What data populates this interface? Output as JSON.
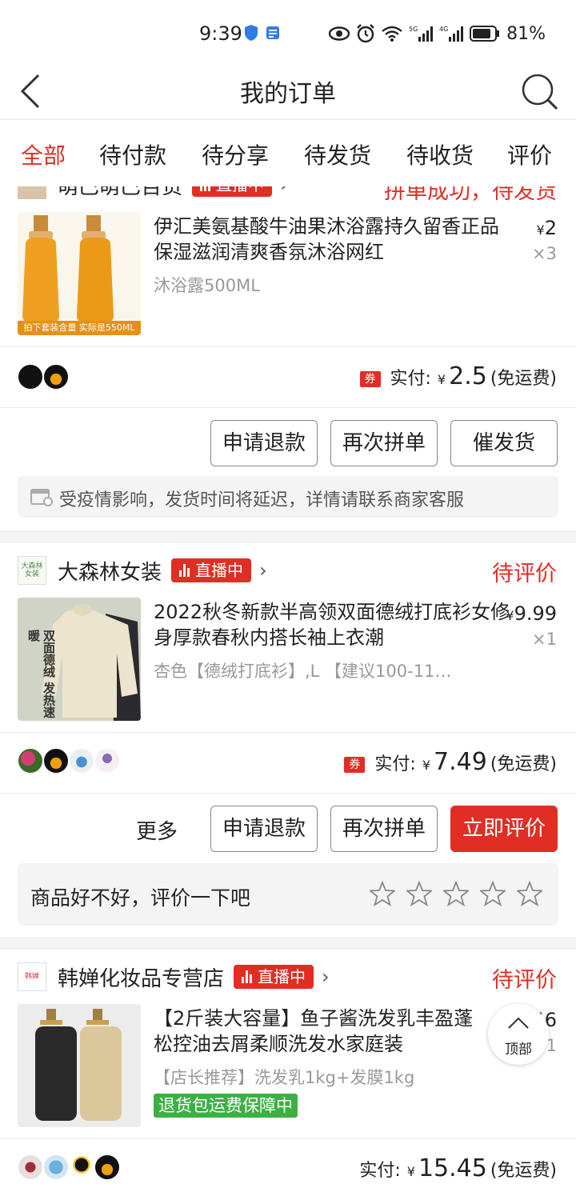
{
  "status_bar": {
    "time": "9:39",
    "battery_pct": "81%",
    "icons": [
      "shield-icon",
      "app-icon",
      "eye-icon",
      "alarm-icon",
      "wifi-icon",
      "signal-5g-icon",
      "signal-4g-icon",
      "battery-icon"
    ]
  },
  "header": {
    "title": "我的订单"
  },
  "tabs": [
    {
      "label": "全部",
      "active": true
    },
    {
      "label": "待付款",
      "active": false
    },
    {
      "label": "待分享",
      "active": false
    },
    {
      "label": "待发货",
      "active": false
    },
    {
      "label": "待收货",
      "active": false
    },
    {
      "label": "评价",
      "active": false
    }
  ],
  "orders": [
    {
      "shop_name": "萌巴萌巴百货",
      "live_label": "直播中",
      "status": "拼单成功，待发货",
      "product_title": "伊汇美氨基酸牛油果沐浴露持久留香正品保湿滋润清爽香氛沐浴网红",
      "spec": "沐浴露500ML",
      "price": "2",
      "qty": "×3",
      "thumb_caption": "拍下套装含量 实际是550ML",
      "pay_label": "实付:",
      "pay_amount": "2.5",
      "shipping": "(免运费)",
      "coupon": "券",
      "buttons": [
        "申请退款",
        "再次拼单",
        "催发货"
      ],
      "notice": "受疫情影响，发货时间将延迟，详情请联系商家客服"
    },
    {
      "shop_logo_text": "大森林女装",
      "shop_name": "大森林女装",
      "live_label": "直播中",
      "status": "待评价",
      "product_title": "2022秋冬新款半高领双面德绒打底衫女修身厚款春秋内搭长袖上衣潮",
      "spec": "杏色【德绒打底衫】,L 【建议100-11…",
      "price": "9.99",
      "qty": "×1",
      "thumb_caption": "双面德绒 发热速暖",
      "pay_label": "实付:",
      "pay_amount": "7.49",
      "shipping": "(免运费)",
      "coupon": "券",
      "more_label": "更多",
      "buttons": [
        "申请退款",
        "再次拼单",
        "立即评价"
      ],
      "review_prompt": "商品好不好，评价一下吧"
    },
    {
      "shop_logo_text": "韩婵",
      "shop_name": "韩婵化妆品专营店",
      "live_label": "直播中",
      "status": "待评价",
      "product_title": "【2斤装大容量】鱼子酱洗发乳丰盈蓬松控油去屑柔顺洗发水家庭装",
      "spec": "【店长推荐】洗发乳1kg+发膜1kg",
      "price": "15.46",
      "qty": "1",
      "guarantee": "退货包运费保障中",
      "pay_label": "实付:",
      "pay_amount": "15.45",
      "shipping": "(免运费)"
    }
  ],
  "back_to_top": "顶部",
  "yen_symbol": "¥",
  "colors": {
    "accent": "#e02e24",
    "guarantee": "#3cb043",
    "muted": "#999999"
  }
}
